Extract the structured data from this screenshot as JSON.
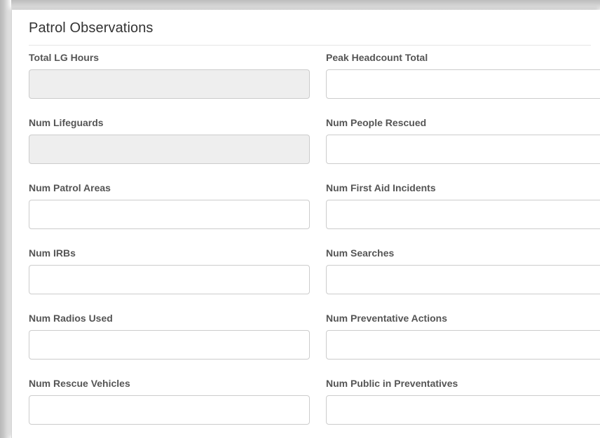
{
  "panel": {
    "title": "Patrol Observations"
  },
  "fields": {
    "left": [
      {
        "label": "Total LG Hours",
        "value": "",
        "readonly": true
      },
      {
        "label": "Num Lifeguards",
        "value": "",
        "readonly": true
      },
      {
        "label": "Num Patrol Areas",
        "value": "",
        "readonly": false
      },
      {
        "label": "Num IRBs",
        "value": "",
        "readonly": false
      },
      {
        "label": "Num Radios Used",
        "value": "",
        "readonly": false
      },
      {
        "label": "Num Rescue Vehicles",
        "value": "",
        "readonly": false
      }
    ],
    "right": [
      {
        "label": "Peak Headcount Total",
        "value": "",
        "readonly": false
      },
      {
        "label": "Num People Rescued",
        "value": "",
        "readonly": false
      },
      {
        "label": "Num First Aid Incidents",
        "value": "",
        "readonly": false
      },
      {
        "label": "Num Searches",
        "value": "",
        "readonly": false
      },
      {
        "label": "Num Preventative Actions",
        "value": "",
        "readonly": false
      },
      {
        "label": "Num Public in Preventatives",
        "value": "",
        "readonly": false
      }
    ]
  },
  "colors": {
    "readonly_background": "#eeeeee",
    "input_border": "#cccccc",
    "label_text": "#555555",
    "title_text": "#333333"
  }
}
